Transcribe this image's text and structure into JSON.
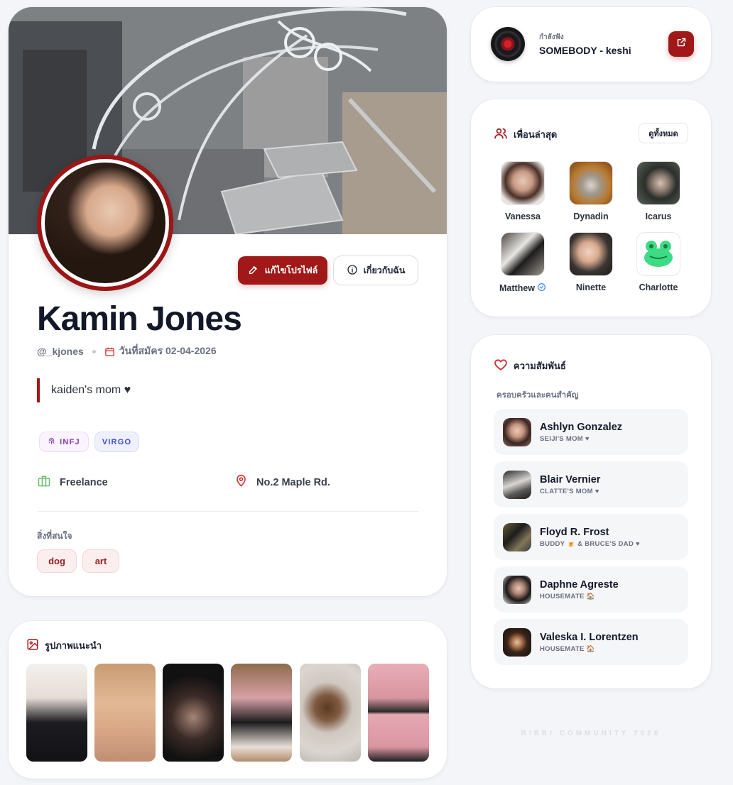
{
  "colors": {
    "accent": "#a01818",
    "page_bg": "#f4f5f8",
    "mbti_tag": "#8a3bb0",
    "zodiac_tag": "#3b4cc9",
    "work_icon": "#4caf50",
    "location_icon": "#d32f2f"
  },
  "profile": {
    "name": "Kamin Jones",
    "handle": "@_kjones",
    "joined_label": "วันที่สมัคร 02-04-2026",
    "bio": "kaiden's mom ♥",
    "edit_button": "แก้ไขโปรไฟล์",
    "about_button": "เกี่ยวกับฉัน",
    "tags": {
      "mbti": "INFJ",
      "zodiac": "VIRGO"
    },
    "work": "Freelance",
    "location": "No.2 Maple Rd.",
    "interests_label": "สิ่งที่สนใจ",
    "interests": [
      "dog",
      "art"
    ]
  },
  "photos": {
    "title": "รูปภาพแนะนำ",
    "count": 6
  },
  "music": {
    "label": "กำลังฟัง",
    "song": "SOMEBODY - keshi",
    "icons": [
      "vinyl-disc-icon",
      "external-link-icon"
    ]
  },
  "friends": {
    "title": "เพื่อนล่าสุด",
    "see_all": "ดูทั้งหมด",
    "items": [
      {
        "name": "Vanessa",
        "verified": false
      },
      {
        "name": "Dynadin",
        "verified": false
      },
      {
        "name": "Icarus",
        "verified": false
      },
      {
        "name": "Matthew",
        "verified": true
      },
      {
        "name": "Ninette",
        "verified": false
      },
      {
        "name": "Charlotte",
        "verified": false
      }
    ]
  },
  "relations": {
    "title": "ความสัมพันธ์",
    "subtitle": "ครอบครัวและคนสำคัญ",
    "items": [
      {
        "name": "Ashlyn Gonzalez",
        "role": "SEIJI'S MOM ♥"
      },
      {
        "name": "Blair Vernier",
        "role": "CLATTE'S MOM ♥"
      },
      {
        "name": "Floyd R. Frost",
        "role": "BUDDY 🍺 & BRUCE'S DAD ♥"
      },
      {
        "name": "Daphne Agreste",
        "role": "HOUSEMATE 🏠"
      },
      {
        "name": "Valeska I. Lorentzen",
        "role": "HOUSEMATE 🏠"
      }
    ]
  },
  "footer": "RIBBI COMMUNITY 2026"
}
